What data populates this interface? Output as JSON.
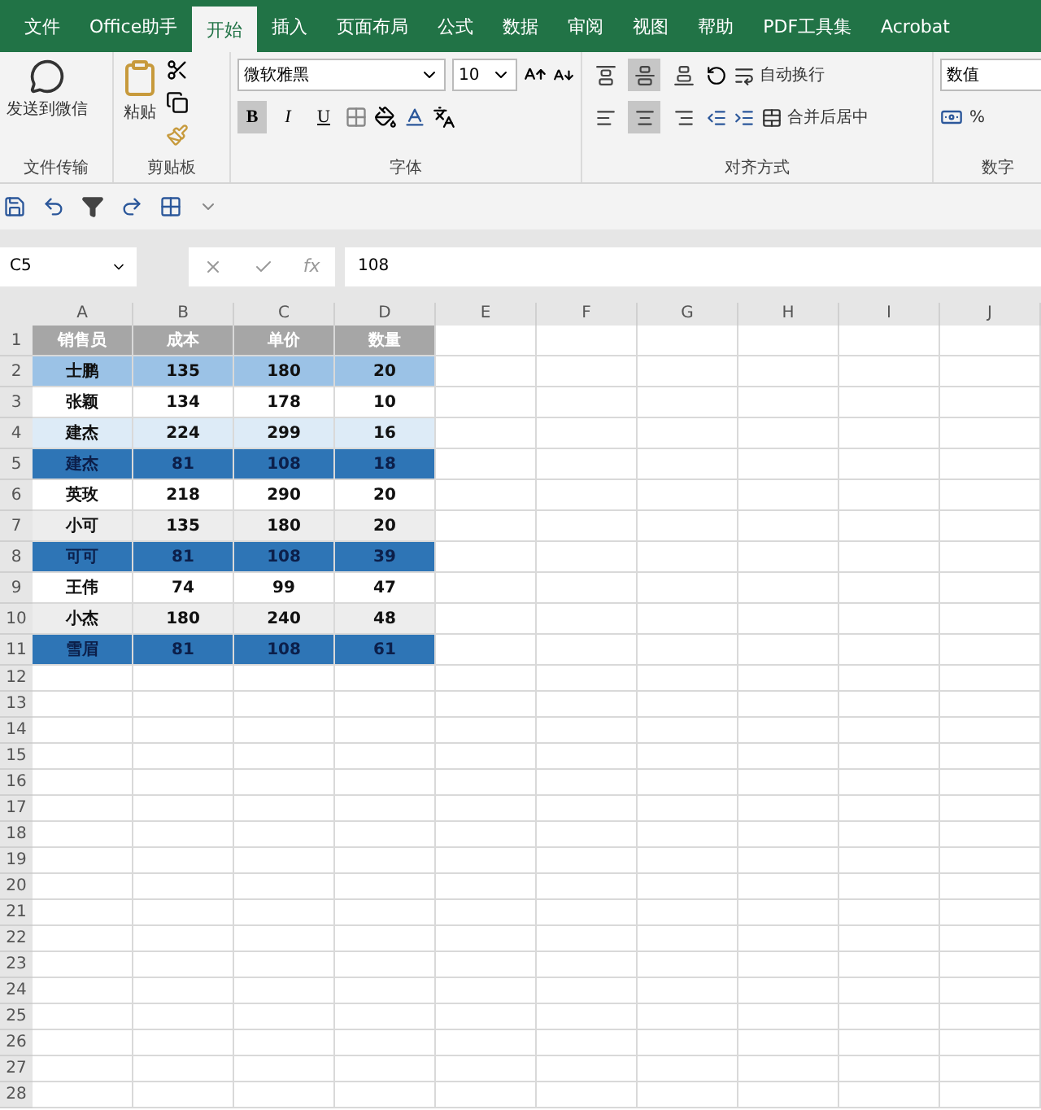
{
  "tabs": [
    {
      "label": "文件",
      "selected": false
    },
    {
      "label": "Office助手",
      "selected": false
    },
    {
      "label": "开始",
      "selected": true
    },
    {
      "label": "插入",
      "selected": false
    },
    {
      "label": "页面布局",
      "selected": false
    },
    {
      "label": "公式",
      "selected": false
    },
    {
      "label": "数据",
      "selected": false
    },
    {
      "label": "审阅",
      "selected": false
    },
    {
      "label": "视图",
      "selected": false
    },
    {
      "label": "帮助",
      "selected": false
    },
    {
      "label": "PDF工具集",
      "selected": false
    },
    {
      "label": "Acrobat",
      "selected": false
    }
  ],
  "ribbon": {
    "transfer": {
      "button": "发送到微信",
      "group": "文件传输"
    },
    "clipboard": {
      "paste": "粘贴",
      "group": "剪贴板"
    },
    "font": {
      "name": "微软雅黑",
      "size": "10",
      "styles": [
        {
          "label": "B",
          "selected": true
        },
        {
          "label": "I",
          "selected": false
        },
        {
          "label": "U",
          "selected": false
        }
      ],
      "group": "字体"
    },
    "alignment": {
      "vertical": [
        {
          "selected": false
        },
        {
          "selected": true
        },
        {
          "selected": false
        }
      ],
      "horizontal": [
        {
          "selected": false
        },
        {
          "selected": true
        },
        {
          "selected": false
        }
      ],
      "wrap": "自动换行",
      "merge": "合并后居中",
      "group": "对齐方式"
    },
    "number": {
      "format": "数值",
      "percent": "%",
      "group": "数字"
    }
  },
  "formula_bar": {
    "name_box": "C5",
    "fx": "fx",
    "value": "108"
  },
  "sheet": {
    "columns": [
      "A",
      "B",
      "C",
      "D",
      "E",
      "F",
      "G",
      "H",
      "I",
      "J"
    ],
    "rows": [
      {
        "number": "1",
        "kind": "header",
        "color": "#a6a6a6",
        "cells": [
          "销售员",
          "成本",
          "单价",
          "数量"
        ]
      },
      {
        "number": "2",
        "kind": "data",
        "color": "#9bc2e6",
        "cells": [
          "士鹏",
          "135",
          "180",
          "20"
        ]
      },
      {
        "number": "3",
        "kind": "data",
        "color": "#ffffff",
        "cells": [
          "张颖",
          "134",
          "178",
          "10"
        ]
      },
      {
        "number": "4",
        "kind": "data",
        "color": "#ddebf7",
        "cells": [
          "建杰",
          "224",
          "299",
          "16"
        ]
      },
      {
        "number": "5",
        "kind": "data",
        "color": "#2e75b6",
        "cells": [
          "建杰",
          "81",
          "108",
          "18"
        ]
      },
      {
        "number": "6",
        "kind": "data",
        "color": "#ffffff",
        "cells": [
          "英玫",
          "218",
          "290",
          "20"
        ]
      },
      {
        "number": "7",
        "kind": "data",
        "color": "#ededed",
        "cells": [
          "小可",
          "135",
          "180",
          "20"
        ]
      },
      {
        "number": "8",
        "kind": "data",
        "color": "#2e75b6",
        "cells": [
          "可可",
          "81",
          "108",
          "39"
        ]
      },
      {
        "number": "9",
        "kind": "data",
        "color": "#ffffff",
        "cells": [
          "王伟",
          "74",
          "99",
          "47"
        ]
      },
      {
        "number": "10",
        "kind": "data",
        "color": "#ededed",
        "cells": [
          "小杰",
          "180",
          "240",
          "48"
        ]
      },
      {
        "number": "11",
        "kind": "data",
        "color": "#2e75b6",
        "cells": [
          "雪眉",
          "81",
          "108",
          "61"
        ]
      },
      {
        "number": "12"
      },
      {
        "number": "13"
      },
      {
        "number": "14"
      },
      {
        "number": "15"
      },
      {
        "number": "16"
      },
      {
        "number": "17"
      },
      {
        "number": "18"
      },
      {
        "number": "19"
      },
      {
        "number": "20"
      },
      {
        "number": "21"
      },
      {
        "number": "22"
      },
      {
        "number": "23"
      },
      {
        "number": "24"
      },
      {
        "number": "25"
      },
      {
        "number": "26"
      },
      {
        "number": "27"
      },
      {
        "number": "28"
      }
    ]
  }
}
